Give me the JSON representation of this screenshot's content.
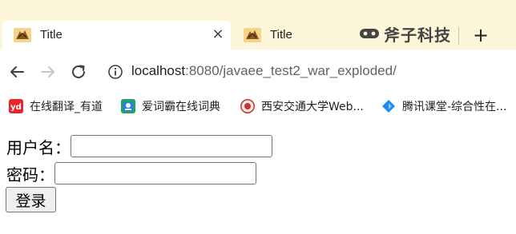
{
  "browser": {
    "tabs": [
      {
        "title": "Title",
        "active": true,
        "close_glyph": "×"
      },
      {
        "title": "Title",
        "active": false
      }
    ],
    "new_tab_glyph": "+",
    "watermark": {
      "text": "斧子科技"
    },
    "address": {
      "host": "localhost",
      "rest": ":8080/javaee_test2_war_exploded/"
    },
    "bookmarks": [
      {
        "label": "在线翻译_有道",
        "icon": "youdao-icon",
        "color": "#e8262d"
      },
      {
        "label": "爱词霸在线词典",
        "icon": "iciba-icon",
        "color": "#1fa463"
      },
      {
        "label": "西安交通大学Web...",
        "icon": "xjtu-icon",
        "color": "#c8312c"
      },
      {
        "label": "腾讯课堂-综合性在...",
        "icon": "tencent-classroom-icon",
        "color": "#1c8cf0"
      }
    ]
  },
  "page": {
    "username_label": "用户名：",
    "password_label": "密码：",
    "username_value": "",
    "password_value": "",
    "login_button": "登录"
  },
  "colors": {
    "tabstrip_bg": "#fdf6d8",
    "accent_blue": "#1a73e8"
  }
}
